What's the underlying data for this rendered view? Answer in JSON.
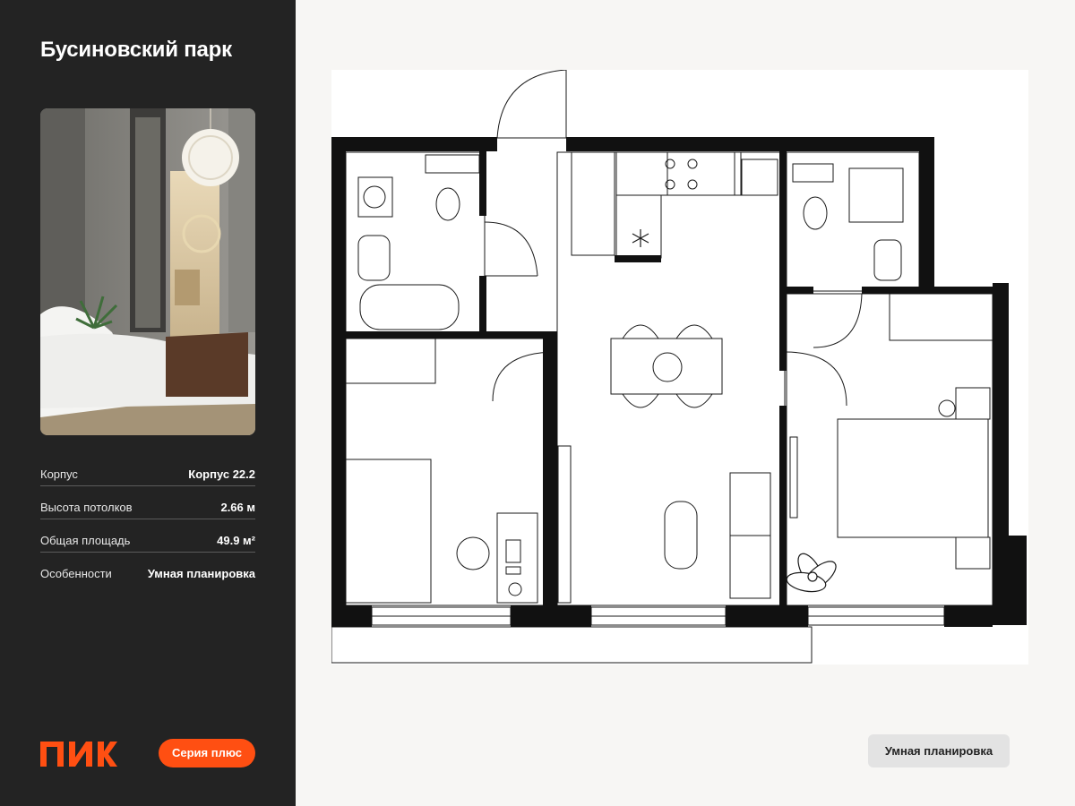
{
  "project": {
    "title": "Бусиновский парк"
  },
  "specs": [
    {
      "label": "Корпус",
      "value": "Корпус 22.2"
    },
    {
      "label": "Высота потолков",
      "value": "2.66 м"
    },
    {
      "label": "Общая площадь",
      "value": "49.9 м²"
    },
    {
      "label": "Особенности",
      "value": "Умная планировка"
    }
  ],
  "brand": {
    "logo": "ПИК",
    "series_badge": "Серия плюс"
  },
  "feature_tag": "Умная планировка",
  "colors": {
    "sidebar_bg": "#232323",
    "accent": "#ff4f12",
    "page_bg": "#f7f6f4",
    "tag_bg": "#e3e3e3"
  },
  "icons": [
    "snowflake-icon",
    "stove-icon",
    "plant-icon"
  ]
}
